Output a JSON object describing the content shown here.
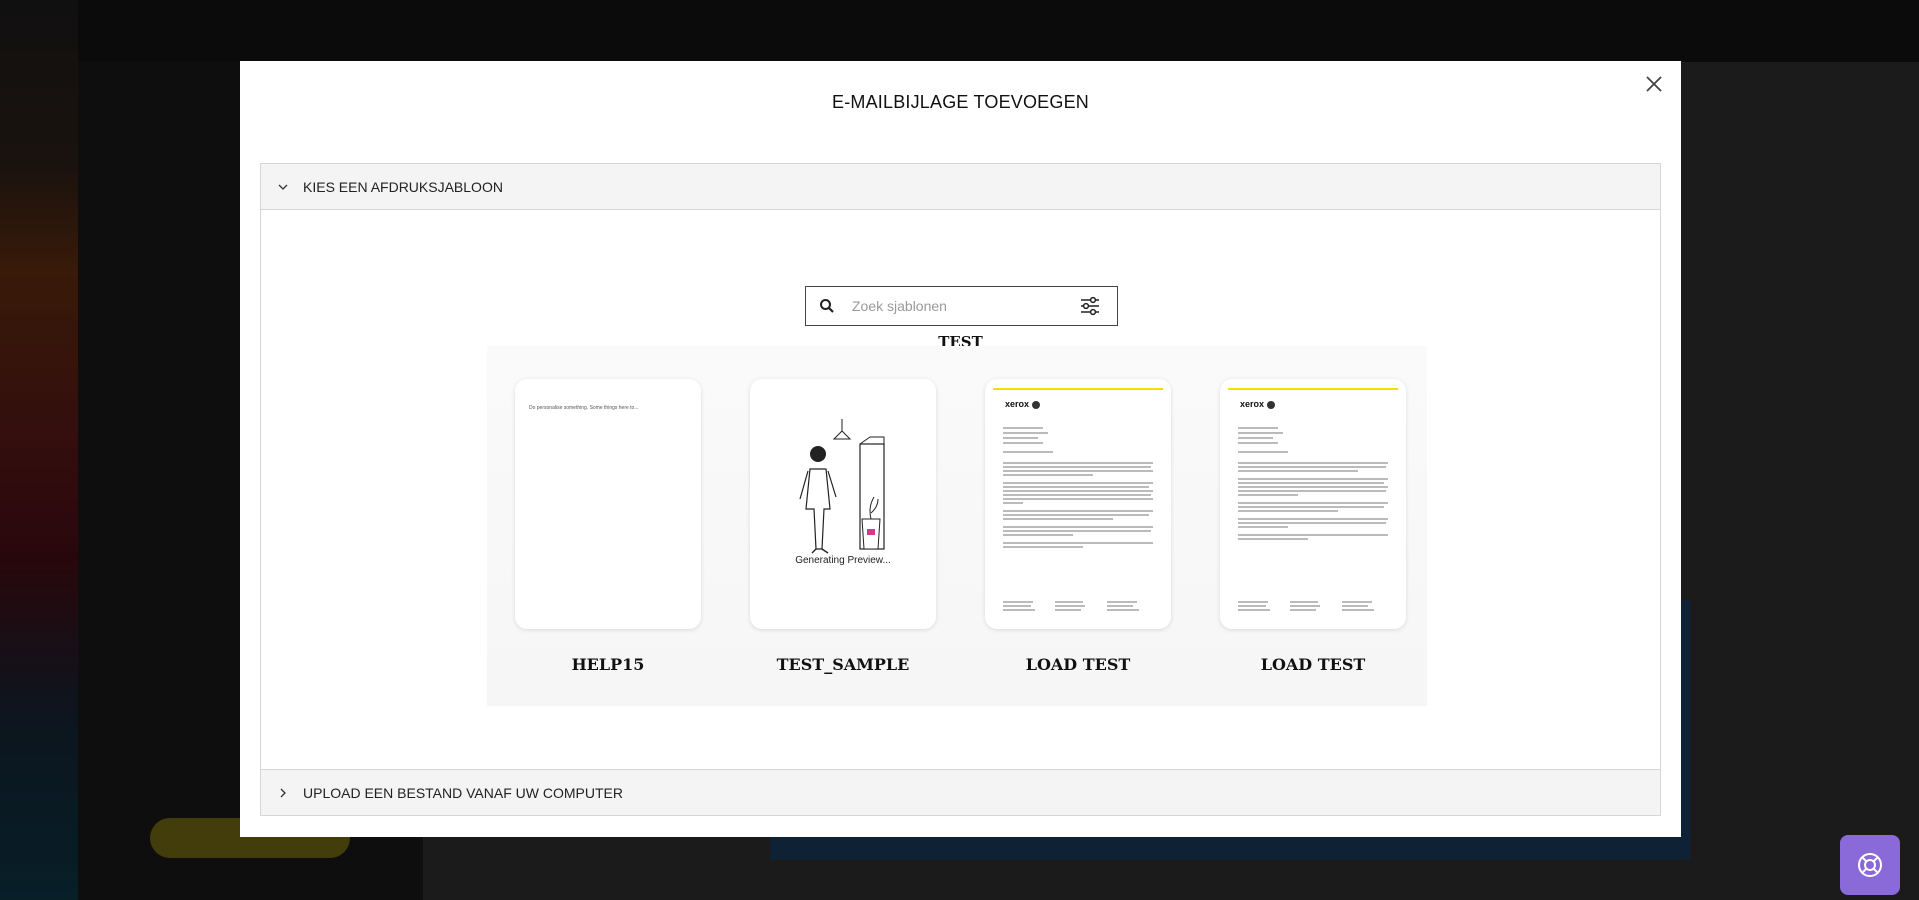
{
  "modal": {
    "title": "E-MAILBIJLAGE TOEVOEGEN",
    "close_icon": "close-icon"
  },
  "sections": [
    {
      "label": "KIES EEN AFDRUKSJABLOON",
      "expanded": true,
      "icon": "chevron-down-icon"
    },
    {
      "label": "UPLOAD EEN BESTAND VANAF UW COMPUTER",
      "expanded": false,
      "icon": "chevron-right-icon"
    }
  ],
  "search": {
    "placeholder": "Zoek sjablonen",
    "value": "",
    "icon": "search-icon",
    "filter_icon": "filter-sliders-icon"
  },
  "group": {
    "label": "TEST",
    "templates": [
      {
        "name": "HELP15",
        "preview_text": "Do personalise something. Some things here to..."
      },
      {
        "name": "TEST_SAMPLE",
        "preview_text": "Generating Preview..."
      },
      {
        "name": "LOAD TEST",
        "logo_text": "xerox"
      },
      {
        "name": "LOAD TEST",
        "logo_text": "xerox"
      }
    ]
  },
  "help_button": {
    "icon": "lifebuoy-icon"
  },
  "colors": {
    "accent_yellow": "#f2e000",
    "help_purple": "#8a6ad8",
    "overlay": "#1e1e1e"
  }
}
